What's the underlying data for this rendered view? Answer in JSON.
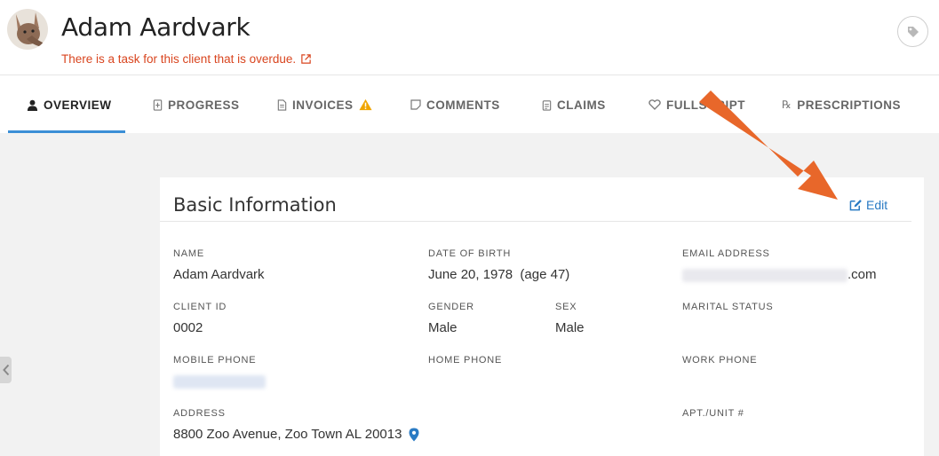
{
  "header": {
    "client_name": "Adam Aardvark",
    "overdue_notice": "There is a task for this client that is overdue.",
    "avatar_icon": "aardvark-avatar",
    "tag_icon": "tag-icon"
  },
  "tabs": [
    {
      "label": "OVERVIEW",
      "icon": "user-icon",
      "active": true
    },
    {
      "label": "PROGRESS",
      "icon": "progress-icon",
      "active": false
    },
    {
      "label": "INVOICES",
      "icon": "document-icon",
      "active": false,
      "warning": true
    },
    {
      "label": "COMMENTS",
      "icon": "note-icon",
      "active": false
    },
    {
      "label": "CLAIMS",
      "icon": "clipboard-icon",
      "active": false
    },
    {
      "label": "FULLSCRIPT",
      "icon": "heart-icon",
      "active": false
    },
    {
      "label": "PRESCRIPTIONS",
      "icon": "rx-icon",
      "active": false
    }
  ],
  "card": {
    "title": "Basic Information",
    "edit_label": "Edit",
    "fields": {
      "name": {
        "label": "NAME",
        "value": "Adam Aardvark"
      },
      "dob": {
        "label": "DATE OF BIRTH",
        "value": "June 20, 1978  (age 47)"
      },
      "email": {
        "label": "EMAIL ADDRESS",
        "value_suffix": ".com"
      },
      "client_id": {
        "label": "CLIENT ID",
        "value": "0002"
      },
      "gender": {
        "label": "GENDER",
        "value": "Male"
      },
      "sex": {
        "label": "SEX",
        "value": "Male"
      },
      "marital": {
        "label": "MARITAL STATUS",
        "value": ""
      },
      "mobile": {
        "label": "MOBILE PHONE"
      },
      "home": {
        "label": "HOME PHONE",
        "value": ""
      },
      "work": {
        "label": "WORK PHONE",
        "value": ""
      },
      "address": {
        "label": "ADDRESS",
        "value": "8800 Zoo Avenue, Zoo Town AL 20013"
      },
      "apt": {
        "label": "APT./UNIT #",
        "value": ""
      }
    }
  },
  "colors": {
    "accent": "#2a7bc4",
    "alert": "#d9451f",
    "warning": "#f0a500",
    "arrow": "#e8672a",
    "active_underline": "#3b8fd6"
  }
}
